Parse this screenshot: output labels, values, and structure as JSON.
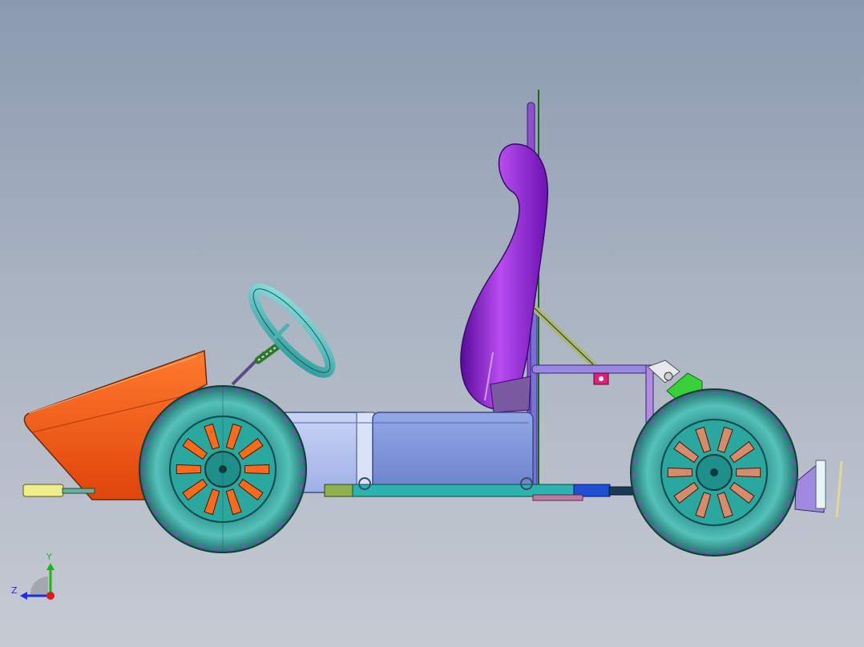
{
  "viewport": {
    "background_top": "#8b9ab0",
    "background_bottom": "#c6cad3"
  },
  "model": {
    "parts": {
      "body_shell_color": "#ff5a14",
      "seat_color": "#8a1fd0",
      "tire_color": "#3aa7a0",
      "hub_color": "#1f8f8c",
      "steering_wheel_color": "#5dc3c3",
      "frame_tube_color": "#8a7fd6",
      "battery_box_color": "#7d95d8",
      "battery_box_light_color": "#b4c3ef",
      "side_bar_color": "#2bb3b0",
      "side_bar_end_color": "#1f4fd6",
      "front_bumper_color": "#e6e67a",
      "shock_color": "#33cc33",
      "rear_bracket_color": "#9b7fd6",
      "spoke_color": "#ff6a1a"
    }
  },
  "triad": {
    "y_label": "Y",
    "z_label": "Z",
    "y_color": "#18b818",
    "z_color": "#1a2fe0",
    "x_color": "#e01818"
  }
}
